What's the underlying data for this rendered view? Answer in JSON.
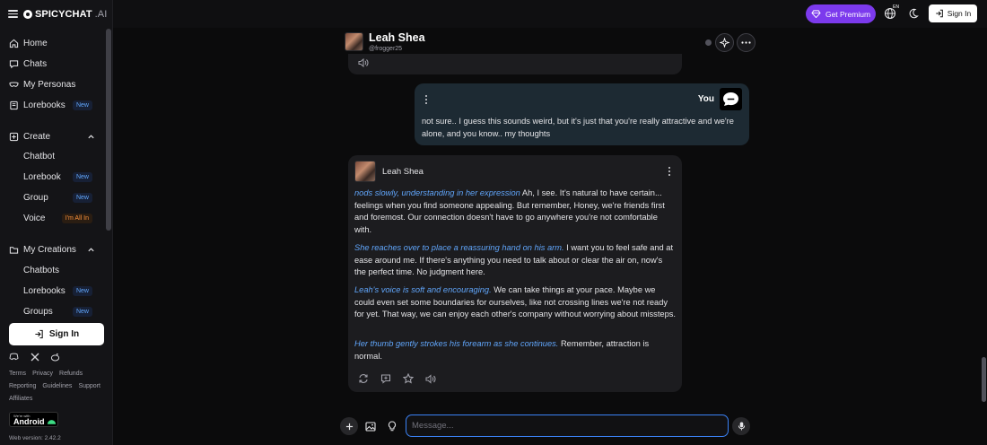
{
  "app": {
    "logo_main": "SPICYCHAT",
    "logo_ai": ".AI"
  },
  "sidebar": {
    "items": [
      {
        "label": "Home",
        "icon": "home-icon"
      },
      {
        "label": "Chats",
        "icon": "chat-icon"
      },
      {
        "label": "My Personas",
        "icon": "mask-icon"
      },
      {
        "label": "Lorebooks",
        "icon": "book-icon",
        "badge": "New"
      }
    ],
    "create": {
      "label": "Create",
      "icon": "plus-square-icon",
      "children": [
        {
          "label": "Chatbot"
        },
        {
          "label": "Lorebook",
          "badge": "New"
        },
        {
          "label": "Group",
          "badge": "New"
        },
        {
          "label": "Voice",
          "badge": "I'm All In"
        }
      ]
    },
    "creations": {
      "label": "My Creations",
      "icon": "folder-icon",
      "children": [
        {
          "label": "Chatbots"
        },
        {
          "label": "Lorebooks",
          "badge": "New"
        },
        {
          "label": "Groups",
          "badge": "New"
        }
      ]
    },
    "sign_in": "Sign In",
    "footer_row1": [
      "Terms",
      "Privacy",
      "Refunds"
    ],
    "footer_row2": [
      "Reporting",
      "Guidelines",
      "Support"
    ],
    "footer_row3": [
      "Affiliates"
    ],
    "android_small": "We're with",
    "android_big": "Android",
    "version": "Web version: 2.42.2"
  },
  "topbar": {
    "premium_label": "Get Premium",
    "lang_code": "EN",
    "sign_in": "Sign In",
    "colors": {
      "premium": "#7c3aed",
      "accent": "#3b82f6"
    }
  },
  "character": {
    "name": "Leah Shea",
    "handle": "@frogger25"
  },
  "user_message": {
    "sender": "You",
    "text": "not sure.. I guess this sounds weird, but it's just that you're really attractive and we're alone, and you know.. my thoughts"
  },
  "bot_message": {
    "sender": "Leah Shea",
    "paragraphs": [
      {
        "action": "nods slowly, understanding in her expression",
        "text": " Ah, I see. It's natural to have certain... feelings when you find someone appealing. But remember, Honey, we're friends first and foremost. Our connection doesn't have to go anywhere you're not comfortable with."
      },
      {
        "action": "She reaches over to place a reassuring hand on his arm.",
        "text": " I want you to feel safe and at ease around me. If there's anything you need to talk about or clear the air on, now's the perfect time. No judgment here."
      },
      {
        "action": "Leah's voice is soft and encouraging.",
        "text": " We can take things at your pace. Maybe we could even set some boundaries for ourselves, like not crossing lines we're not ready for yet. That way, we can enjoy each other's company without worrying about missteps."
      },
      {
        "action": "Her thumb gently strokes his forearm as she continues.",
        "text": " Remember, attraction is normal."
      }
    ]
  },
  "composer": {
    "placeholder": "Message..."
  }
}
